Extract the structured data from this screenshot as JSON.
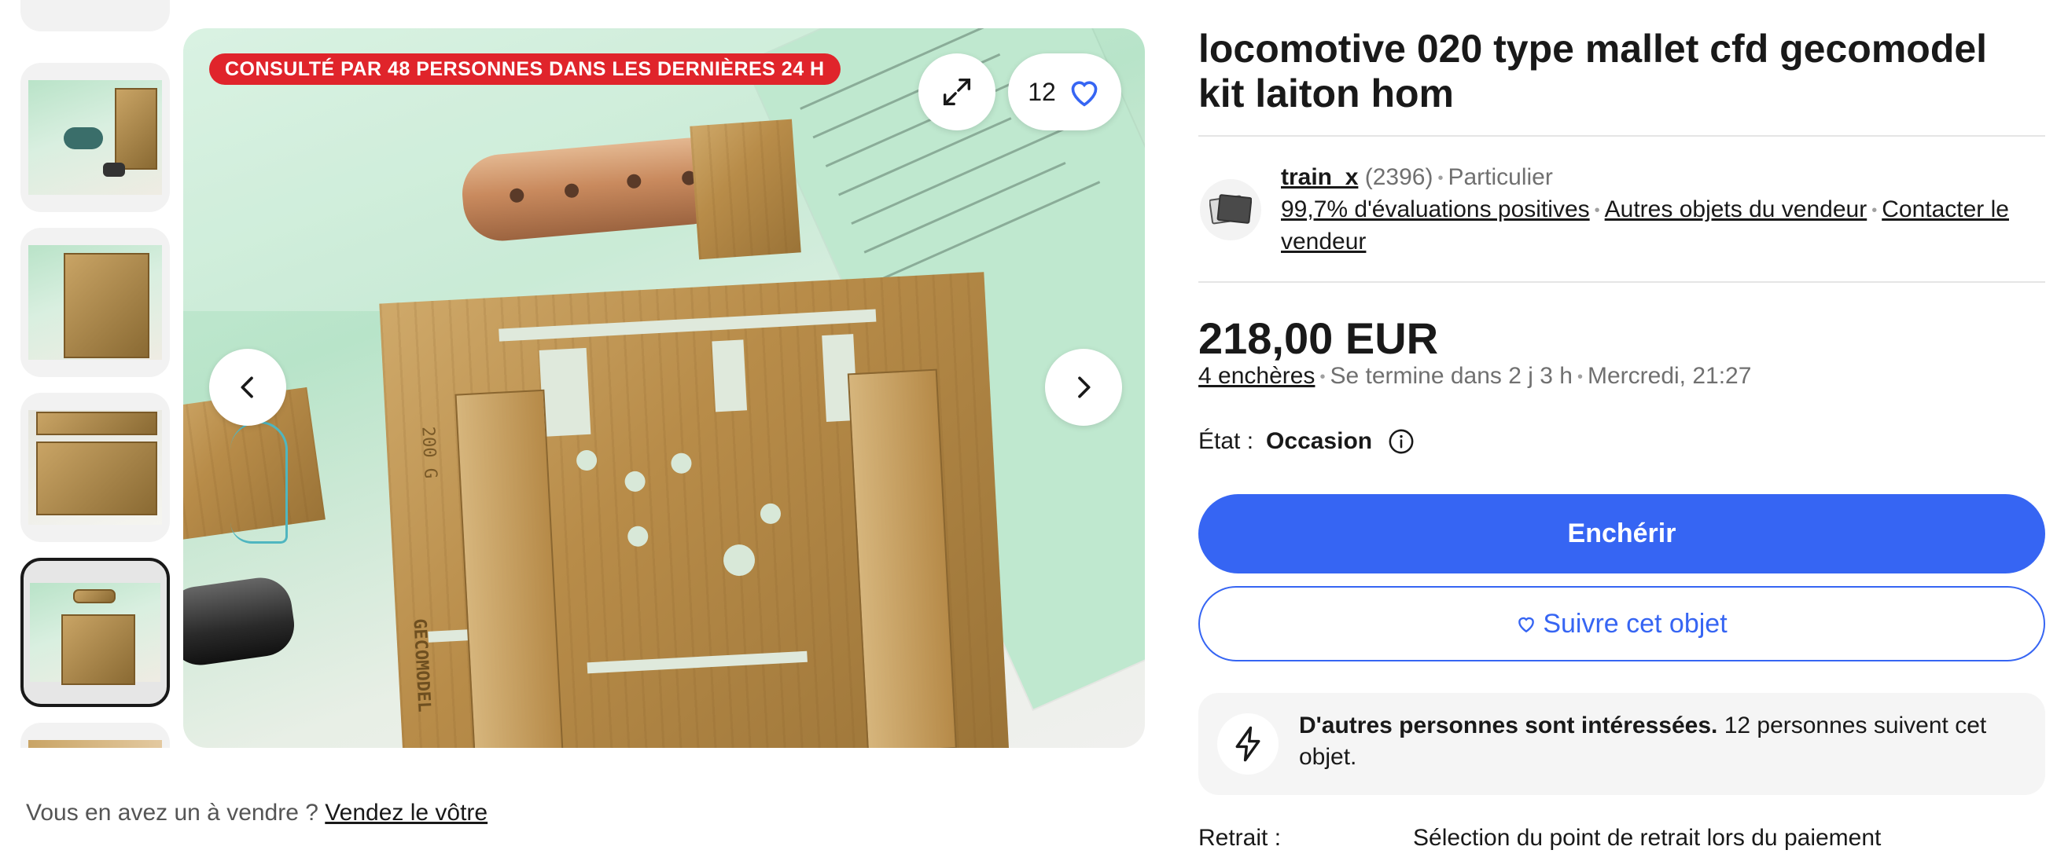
{
  "gallery": {
    "views_badge": "CONSULTÉ PAR 48 PERSONNES DANS LES DERNIÈRES 24 H",
    "watch_count": "12",
    "stamp_text": "200 G",
    "brand_text": "GECOMODEL"
  },
  "sell_prompt": {
    "text": "Vous en avez un à vendre ?",
    "link": "Vendez le vôtre"
  },
  "listing": {
    "title": "locomotive 020 type mallet cfd gecomodel kit laiton hom",
    "seller": {
      "name": "train_x",
      "feedback_count": "(2396)",
      "type": "Particulier",
      "positive": "99,7% d'évaluations positives",
      "other_items": "Autres objets du vendeur",
      "contact": "Contacter le vendeur"
    },
    "price": "218,00 EUR",
    "bids": "4 enchères",
    "ends_in": "Se termine dans 2 j 3 h",
    "ends_at": "Mercredi, 21:27",
    "condition_label": "État :",
    "condition_value": "Occasion",
    "bid_button": "Enchérir",
    "watch_button": "Suivre cet objet",
    "interest_bold": "D'autres personnes sont intéressées.",
    "interest_text": "12 personnes suivent cet objet.",
    "pickup_label": "Retrait :",
    "pickup_value": "Sélection du point de retrait lors du paiement"
  },
  "colors": {
    "accent": "#3665f3",
    "badge_red": "#e0242b",
    "text": "#191919",
    "muted": "#707070"
  }
}
